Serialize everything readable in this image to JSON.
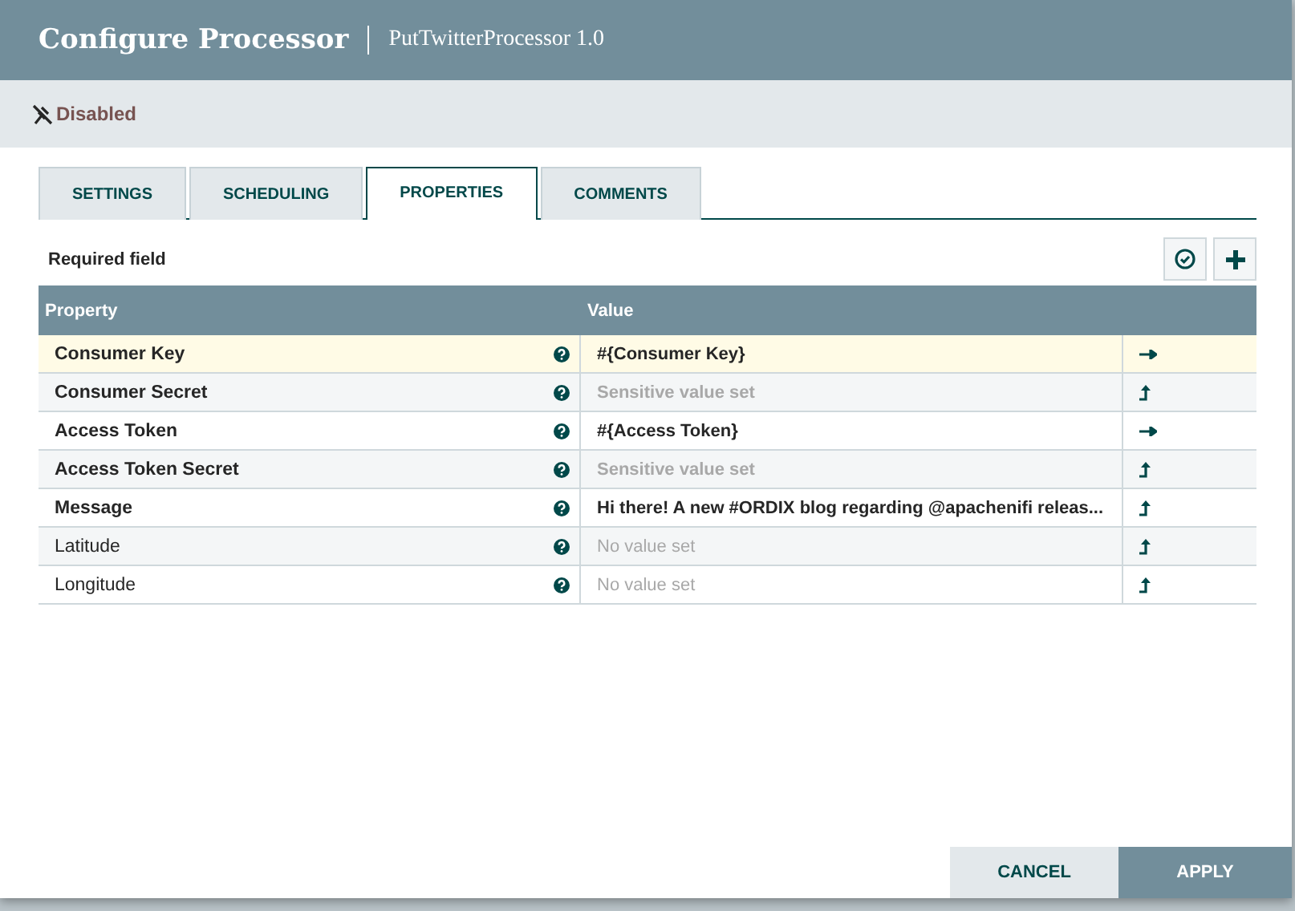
{
  "dialog": {
    "title": "Configure Processor",
    "subtitle": "PutTwitterProcessor 1.0",
    "status": "Disabled"
  },
  "tabs": [
    {
      "label": "SETTINGS",
      "selected": false
    },
    {
      "label": "SCHEDULING",
      "selected": false
    },
    {
      "label": "PROPERTIES",
      "selected": true
    },
    {
      "label": "COMMENTS",
      "selected": false
    }
  ],
  "required_note": "Required field",
  "table": {
    "columns": [
      "Property",
      "Value"
    ],
    "rows": [
      {
        "property": "Consumer Key",
        "required": true,
        "selected": true,
        "value": {
          "text": "#{Consumer Key}",
          "kind": "set"
        },
        "action": {
          "kind": "goto"
        }
      },
      {
        "property": "Consumer Secret",
        "required": true,
        "selected": false,
        "value": {
          "text": "Sensitive value set",
          "kind": "sensitive"
        },
        "action": {
          "kind": "edit"
        }
      },
      {
        "property": "Access Token",
        "required": true,
        "selected": false,
        "value": {
          "text": "#{Access Token}",
          "kind": "set"
        },
        "action": {
          "kind": "goto"
        }
      },
      {
        "property": "Access Token Secret",
        "required": true,
        "selected": false,
        "value": {
          "text": "Sensitive value set",
          "kind": "sensitive"
        },
        "action": {
          "kind": "edit"
        }
      },
      {
        "property": "Message",
        "required": true,
        "selected": false,
        "value": {
          "text": "Hi there! A new #ORDIX blog regarding @apachenifi releas...",
          "kind": "set"
        },
        "action": {
          "kind": "edit"
        }
      },
      {
        "property": "Latitude",
        "required": false,
        "selected": false,
        "value": {
          "text": "No value set",
          "kind": "empty"
        },
        "action": {
          "kind": "edit"
        }
      },
      {
        "property": "Longitude",
        "required": false,
        "selected": false,
        "value": {
          "text": "No value set",
          "kind": "empty"
        },
        "action": {
          "kind": "edit"
        }
      }
    ]
  },
  "buttons": [
    {
      "label": "CANCEL",
      "kind": "secondary"
    },
    {
      "label": "APPLY",
      "kind": "primary"
    }
  ]
}
